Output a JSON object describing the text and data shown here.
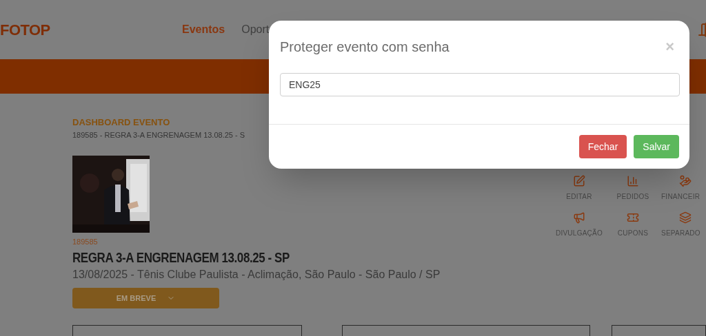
{
  "header": {
    "logo": "FOTOP",
    "nav": [
      {
        "label": "Eventos",
        "selected": true
      },
      {
        "label": "Oport",
        "selected": false
      }
    ]
  },
  "dashboard": {
    "heading": "DASHBOARD EVENTO",
    "subtitle": "189585 - REGRA 3-A ENGRENAGEM 13.08.25 - S",
    "event_id": "189585",
    "title": "REGRA 3-A ENGRENAGEM 13.08.25 - SP",
    "details": "13/08/2025 - Tênis Clube Paulista - Aclimação, São Paulo - São Paulo / SP",
    "status_button": "EM BREVE"
  },
  "actions": [
    {
      "label": "EDITAR"
    },
    {
      "label": "PEDIDOS"
    },
    {
      "label": "FINANCEIR"
    },
    {
      "label": "DIVULGAÇÃO"
    },
    {
      "label": "CUPONS"
    },
    {
      "label": "SEPARADO"
    }
  ],
  "modal": {
    "title": "Proteger evento com senha",
    "close": "×",
    "password_field": {
      "value": "ENG25"
    },
    "buttons": [
      {
        "label": "Fechar",
        "kind": "danger"
      },
      {
        "label": "Salvar",
        "kind": "success"
      }
    ]
  }
}
